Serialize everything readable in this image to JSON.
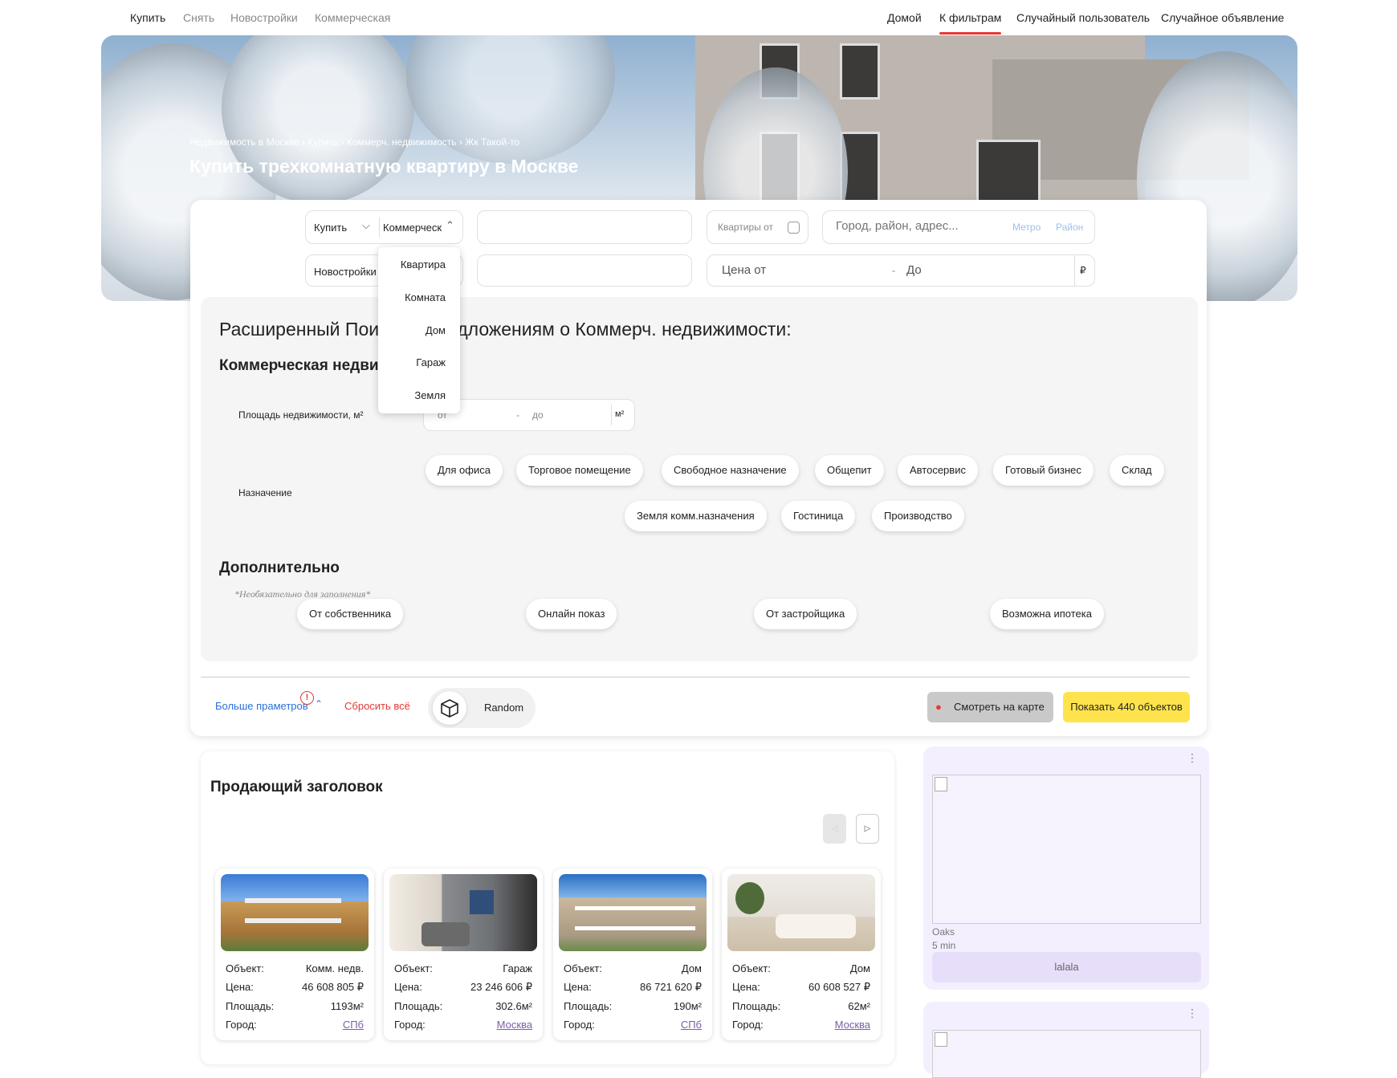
{
  "nav_left": [
    "Купить",
    "Снять",
    "Новостройки",
    "Коммерческая"
  ],
  "nav_right": [
    "Домой",
    "К фильтрам",
    "Случайный пользователь",
    "Случайное объявление"
  ],
  "hero": {
    "breadcrumbs": "Недвижимость в Москве › Купить › Коммерч. недвижимость › Жк Такой-то",
    "title": "Купить трехкомнатную квартиру в Москве"
  },
  "search": {
    "deal": "Купить",
    "type": "Коммерческ",
    "rooms_label": "Квартиры от",
    "location_placeholder": "Город, район, адрес...",
    "metro": "Метро",
    "district": "Район",
    "new_buildings": "Новостройки",
    "price_from": "Цена от",
    "price_to": "До",
    "currency": "₽"
  },
  "dropdown": [
    "Квартира",
    "Комната",
    "Дом",
    "Гараж",
    "Земля"
  ],
  "advanced": {
    "title": "Расширенный Поиск по предложениям о Коммерч. недвижимости:",
    "section_title": "Коммерческая недвижимость",
    "area_label": "Площадь недвижимости, м²",
    "area_from": "от",
    "area_to": "до",
    "area_unit": "м²",
    "purpose_label": "Назначение",
    "purposes": [
      "Для офиса",
      "Торговое помещение",
      "Свободное назначение",
      "Общепит",
      "Автосервис",
      "Готовый бизнес",
      "Склад",
      "Земля комм.назначения",
      "Гостиница",
      "Производство"
    ],
    "extra_title": "Дополнительно",
    "extra_note": "*Необязательно для заполнения*",
    "extras": [
      "От собственника",
      "Онлайн показ",
      "От застройщика",
      "Возможна ипотека"
    ]
  },
  "actions": {
    "more": "Больше праметров",
    "reset": "Сбросить всё",
    "random": "Random",
    "map": "Смотреть на карте",
    "show": "Показать 440 объектов"
  },
  "seller": {
    "title": "Продающий заголовок"
  },
  "props": [
    {
      "object_label": "Объект:",
      "object": "Комм. недв.",
      "price_label": "Цена:",
      "price": "46 608 805 ₽",
      "area_label": "Площадь:",
      "area": "1193м²",
      "city_label": "Город:",
      "city": "СПб"
    },
    {
      "object_label": "Объект:",
      "object": "Гараж",
      "price_label": "Цена:",
      "price": "23 246 606 ₽",
      "area_label": "Площадь:",
      "area": "302.6м²",
      "city_label": "Город:",
      "city": "Москва"
    },
    {
      "object_label": "Объект:",
      "object": "Дом",
      "price_label": "Цена:",
      "price": "86 721 620 ₽",
      "area_label": "Площадь:",
      "area": "190м²",
      "city_label": "Город:",
      "city": "СПб"
    },
    {
      "object_label": "Объект:",
      "object": "Дом",
      "price_label": "Цена:",
      "price": "60 608 527 ₽",
      "area_label": "Площадь:",
      "area": "62м²",
      "city_label": "Город:",
      "city": "Москва"
    }
  ],
  "ad": {
    "name": "Oaks",
    "time": "5 min",
    "button": "lalala"
  },
  "colors": {
    "accent_red": "#e53935",
    "yellow": "#ffe34d",
    "link_blue": "#2b6fd6",
    "purple_bg": "#f4efff"
  }
}
